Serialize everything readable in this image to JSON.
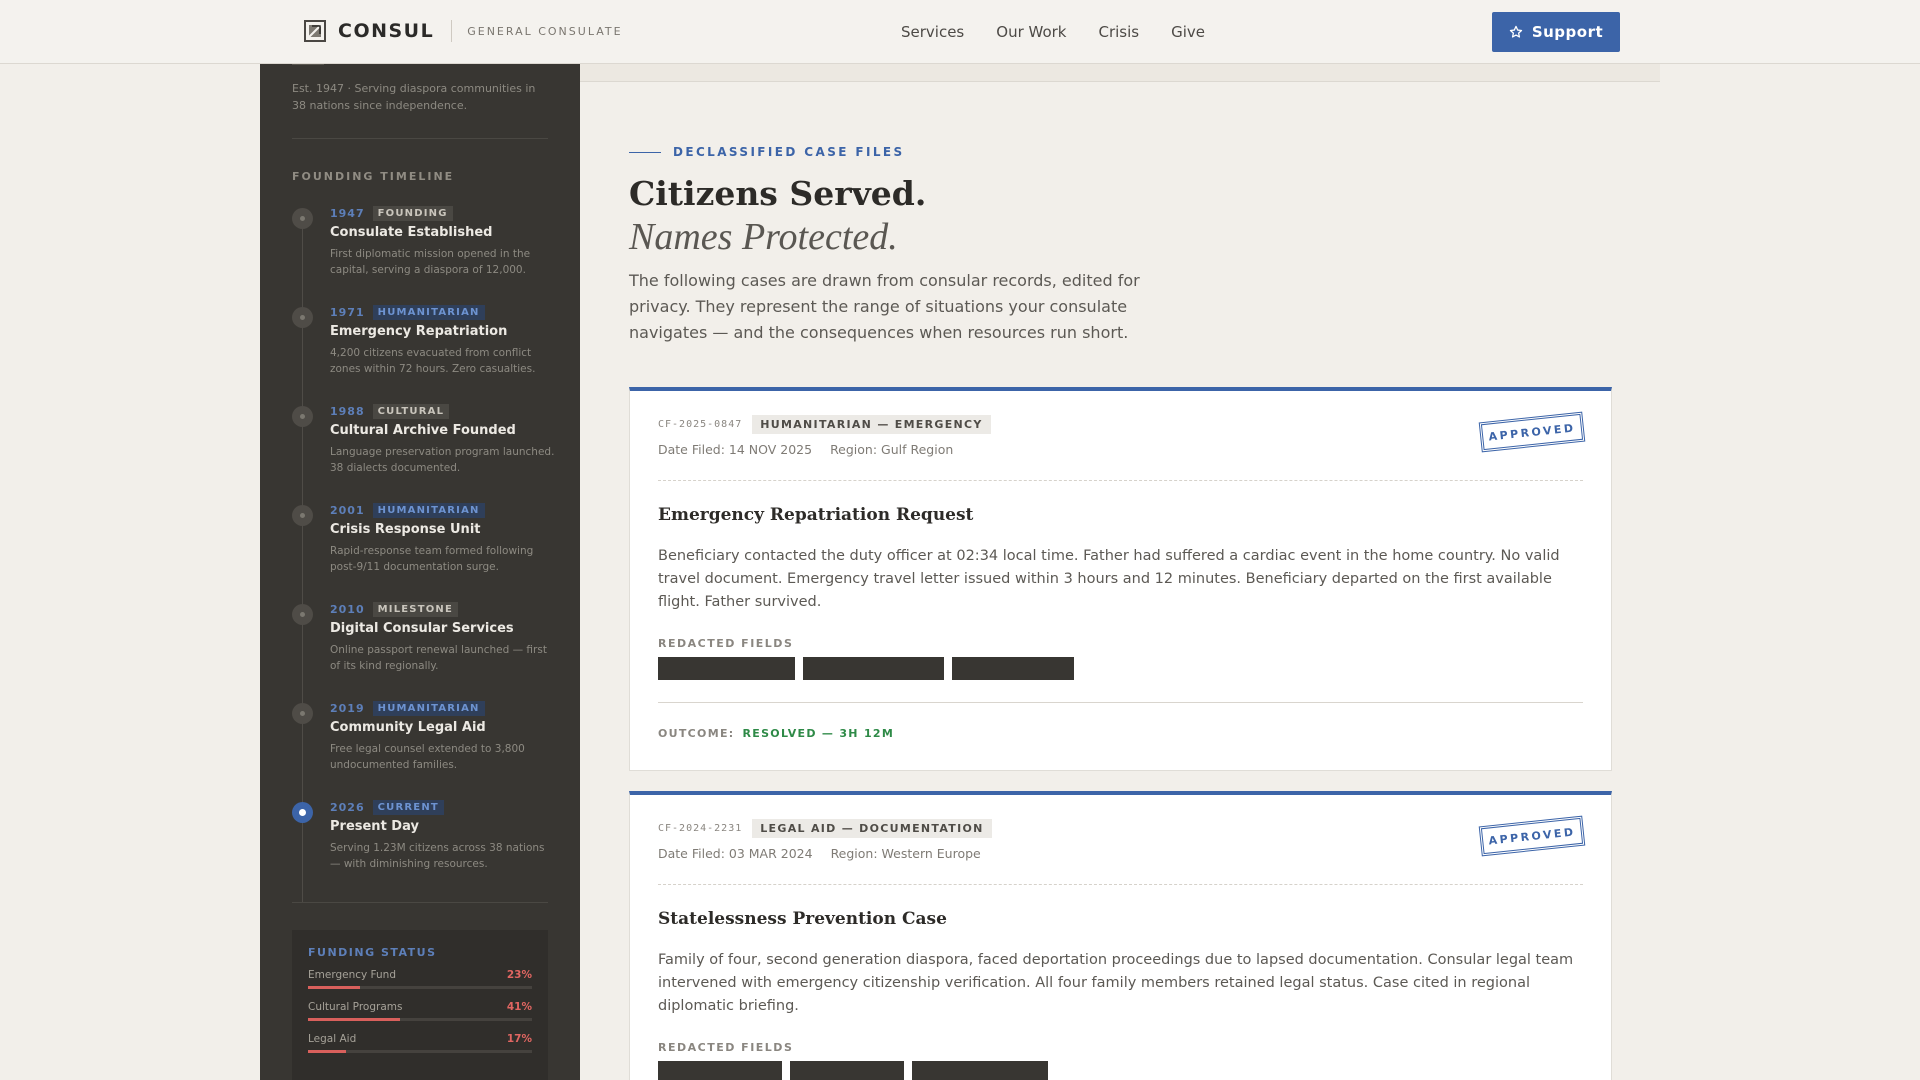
{
  "header": {
    "brand_name": "CONSUL",
    "brand_sub": "GENERAL CONSULATE",
    "nav": [
      "Services",
      "Our Work",
      "Crisis",
      "Give"
    ],
    "support_label": "Support",
    "accent": "#3c64a8"
  },
  "sidebar": {
    "est_text": "Est. 1947 · Serving diaspora communities in 38 nations since independence.",
    "timeline_title": "FOUNDING TIMELINE",
    "timeline": [
      {
        "year": "1947",
        "tag": "FOUNDING",
        "name": "Consulate Established",
        "desc": "First diplomatic mission opened in the capital, serving a diaspora of 12,000."
      },
      {
        "year": "1971",
        "tag": "HUMANITARIAN",
        "name": "Emergency Repatriation",
        "desc": "4,200 citizens evacuated from conflict zones within 72 hours. Zero casualties."
      },
      {
        "year": "1988",
        "tag": "CULTURAL",
        "name": "Cultural Archive Founded",
        "desc": "Language preservation program launched. 38 dialects documented."
      },
      {
        "year": "2001",
        "tag": "HUMANITARIAN",
        "name": "Crisis Response Unit",
        "desc": "Rapid-response team formed following post-9/11 documentation surge."
      },
      {
        "year": "2010",
        "tag": "MILESTONE",
        "name": "Digital Consular Services",
        "desc": "Online passport renewal launched — first of its kind regionally."
      },
      {
        "year": "2019",
        "tag": "HUMANITARIAN",
        "name": "Community Legal Aid",
        "desc": "Free legal counsel extended to 3,800 undocumented families."
      },
      {
        "year": "2026",
        "tag": "CURRENT",
        "name": "Present Day",
        "desc": "Serving 1.23M citizens across 38 nations — with diminishing resources."
      }
    ],
    "funding": {
      "title": "FUNDING STATUS",
      "items": [
        {
          "label": "Emergency Fund",
          "pct": "23%",
          "value": 0.23
        },
        {
          "label": "Cultural Programs",
          "pct": "41%",
          "value": 0.41
        },
        {
          "label": "Legal Aid",
          "pct": "17%",
          "value": 0.17
        }
      ]
    }
  },
  "main": {
    "eyebrow": "DECLASSIFIED CASE FILES",
    "title": "Citizens Served.",
    "subtitle": "Names Protected.",
    "description": "The following cases are drawn from consular records, edited for privacy. They represent the range of situations your consulate navigates — and the consequences when resources run short.",
    "cases": [
      {
        "id": "CF-2025-0847",
        "category": "HUMANITARIAN — EMERGENCY",
        "date": "Date Filed: 14 NOV 2025",
        "region": "Region: Gulf Region",
        "stamp": "APPROVED",
        "title": "Emergency Repatriation Request",
        "body": "Beneficiary contacted the duty officer at 02:34 local time. Father had suffered a cardiac event in the home country. No valid travel document. Emergency travel letter issued within 3 hours and 12 minutes. Beneficiary departed on the first available flight. Father survived.",
        "redacted_label": "REDACTED FIELDS",
        "outcome_label": "OUTCOME:",
        "outcome": "RESOLVED — 3H 12M"
      },
      {
        "id": "CF-2024-2231",
        "category": "LEGAL AID — DOCUMENTATION",
        "date": "Date Filed: 03 MAR 2024",
        "region": "Region: Western Europe",
        "stamp": "APPROVED",
        "title": "Statelessness Prevention Case",
        "body": "Family of four, second generation diaspora, faced deportation proceedings due to lapsed documentation. Consular legal team intervened with emergency citizenship verification. All four family members retained legal status. Case cited in regional diplomatic briefing.",
        "redacted_label": "REDACTED FIELDS"
      }
    ]
  }
}
